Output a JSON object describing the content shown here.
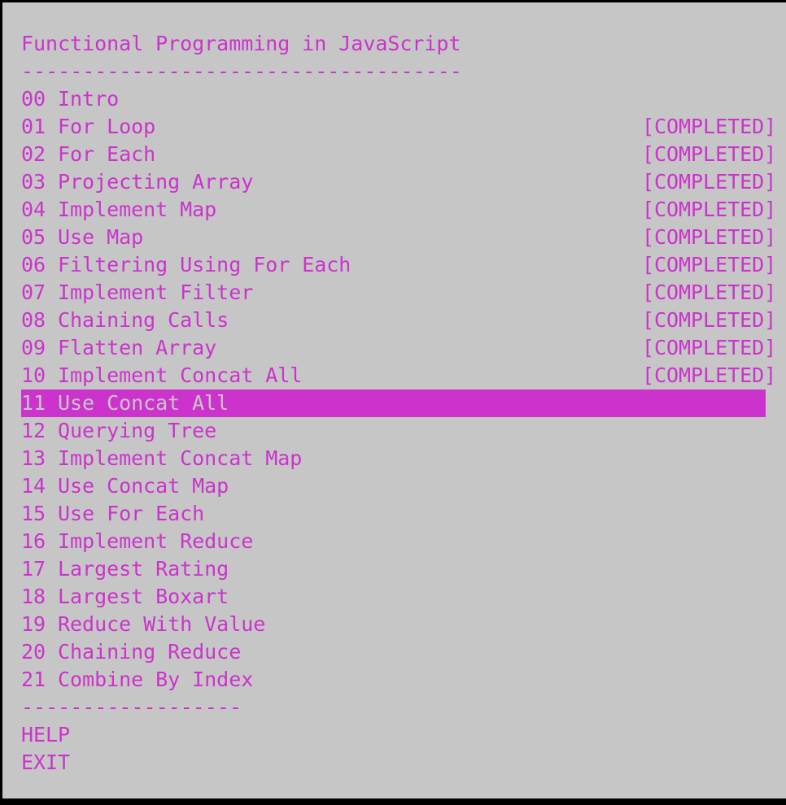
{
  "terminal": {
    "title": "Functional Programming in JavaScript",
    "title_rule": "------------------------------------",
    "footer_rule": "------------------",
    "colors": {
      "background": "#c6c6c6",
      "foreground": "#cc33cc",
      "selected_background": "#cc33cc",
      "selected_foreground": "#c6c6c6",
      "border": "#000000"
    },
    "selected_index": 11,
    "status_completed": "[COMPLETED]",
    "menu_items": [
      {
        "num": "00",
        "label": "00 Intro",
        "status": ""
      },
      {
        "num": "01",
        "label": "01 For Loop",
        "status": "[COMPLETED]"
      },
      {
        "num": "02",
        "label": "02 For Each",
        "status": "[COMPLETED]"
      },
      {
        "num": "03",
        "label": "03 Projecting Array",
        "status": "[COMPLETED]"
      },
      {
        "num": "04",
        "label": "04 Implement Map",
        "status": "[COMPLETED]"
      },
      {
        "num": "05",
        "label": "05 Use Map",
        "status": "[COMPLETED]"
      },
      {
        "num": "06",
        "label": "06 Filtering Using For Each",
        "status": "[COMPLETED]"
      },
      {
        "num": "07",
        "label": "07 Implement Filter",
        "status": "[COMPLETED]"
      },
      {
        "num": "08",
        "label": "08 Chaining Calls",
        "status": "[COMPLETED]"
      },
      {
        "num": "09",
        "label": "09 Flatten Array",
        "status": "[COMPLETED]"
      },
      {
        "num": "10",
        "label": "10 Implement Concat All",
        "status": "[COMPLETED]"
      },
      {
        "num": "11",
        "label": "11 Use Concat All",
        "status": ""
      },
      {
        "num": "12",
        "label": "12 Querying Tree",
        "status": ""
      },
      {
        "num": "13",
        "label": "13 Implement Concat Map",
        "status": ""
      },
      {
        "num": "14",
        "label": "14 Use Concat Map",
        "status": ""
      },
      {
        "num": "15",
        "label": "15 Use For Each",
        "status": ""
      },
      {
        "num": "16",
        "label": "16 Implement Reduce",
        "status": ""
      },
      {
        "num": "17",
        "label": "17 Largest Rating",
        "status": ""
      },
      {
        "num": "18",
        "label": "18 Largest Boxart",
        "status": ""
      },
      {
        "num": "19",
        "label": "19 Reduce With Value",
        "status": ""
      },
      {
        "num": "20",
        "label": "20 Chaining Reduce",
        "status": ""
      },
      {
        "num": "21",
        "label": "21 Combine By Index",
        "status": ""
      }
    ],
    "actions": [
      {
        "label": "HELP"
      },
      {
        "label": "EXIT"
      }
    ]
  }
}
